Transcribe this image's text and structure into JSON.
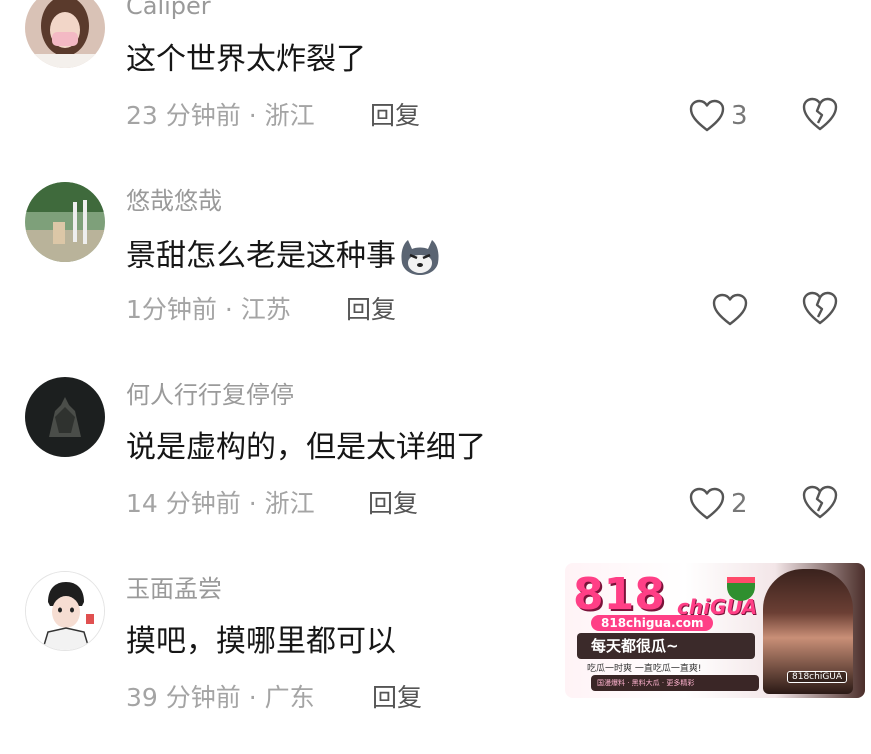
{
  "comments": [
    {
      "username": "Caliper",
      "text": "这个世界太炸裂了",
      "meta": "23 分钟前 · 浙江",
      "reply": "回复",
      "likes": "3",
      "avatar": "avatar-woman-mask"
    },
    {
      "username": "悠哉悠哉",
      "text": "景甜怎么老是这种事",
      "emoji": "husky-emoji",
      "meta": "1分钟前 · 江苏",
      "reply": "回复",
      "likes": "",
      "avatar": "avatar-outdoor-scene"
    },
    {
      "username": "何人行行复停停",
      "text": "说是虚构的，但是太详细了",
      "meta": "14 分钟前 · 浙江",
      "reply": "回复",
      "likes": "2",
      "avatar": "avatar-dark-figure"
    },
    {
      "username": "玉面孟尝",
      "text": "摸吧，摸哪里都可以",
      "meta": "39 分钟前 · 广东",
      "reply": "回复",
      "likes": "",
      "avatar": "avatar-cartoon-man"
    }
  ],
  "ad": {
    "logo": "818",
    "logo_suffix": "chiGUA",
    "url": "818chigua.com",
    "slogan": "每天都很瓜~",
    "subline": "吃瓜一时爽 一直吃瓜一直爽!",
    "bar_text": "国漫爆料 · 黑料大瓜 · 更多精彩",
    "tag": "818chiGUA"
  }
}
